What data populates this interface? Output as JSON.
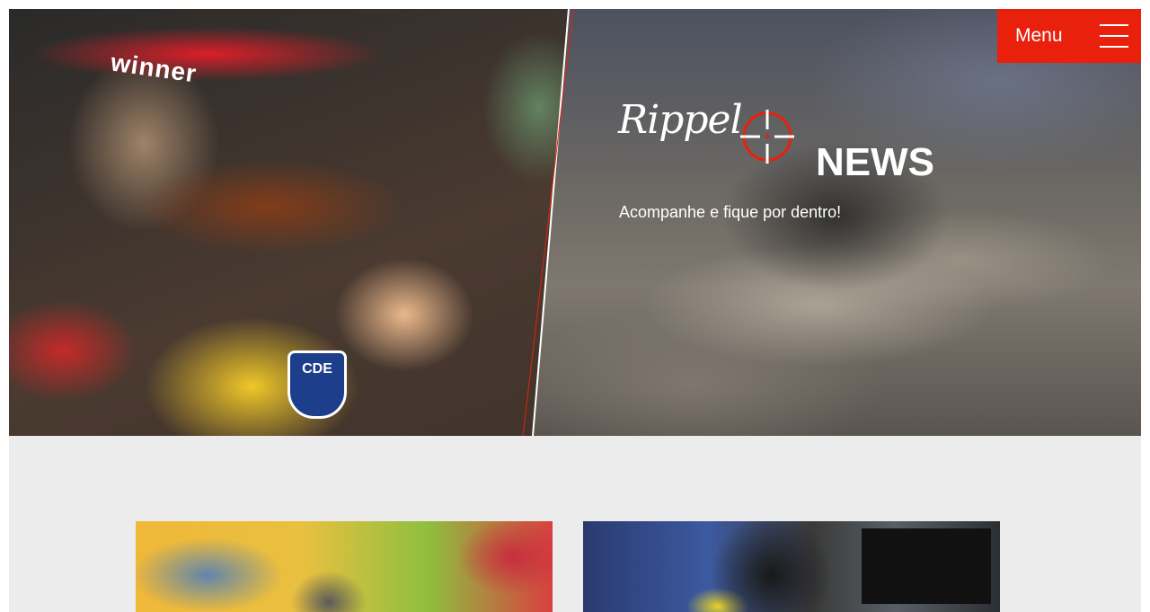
{
  "menu": {
    "label": "Menu"
  },
  "hero": {
    "brand_script": "Rippel",
    "brand_word": "NEWS",
    "tagline": "Acompanhe e fique por dentro!",
    "photo_cap_text": "winner",
    "photo_patch_text": "CDE"
  },
  "colors": {
    "accent": "#e8200c",
    "background": "#ececec"
  },
  "icons": {
    "menu": "hamburger-icon",
    "brand": "crosshair-icon"
  }
}
